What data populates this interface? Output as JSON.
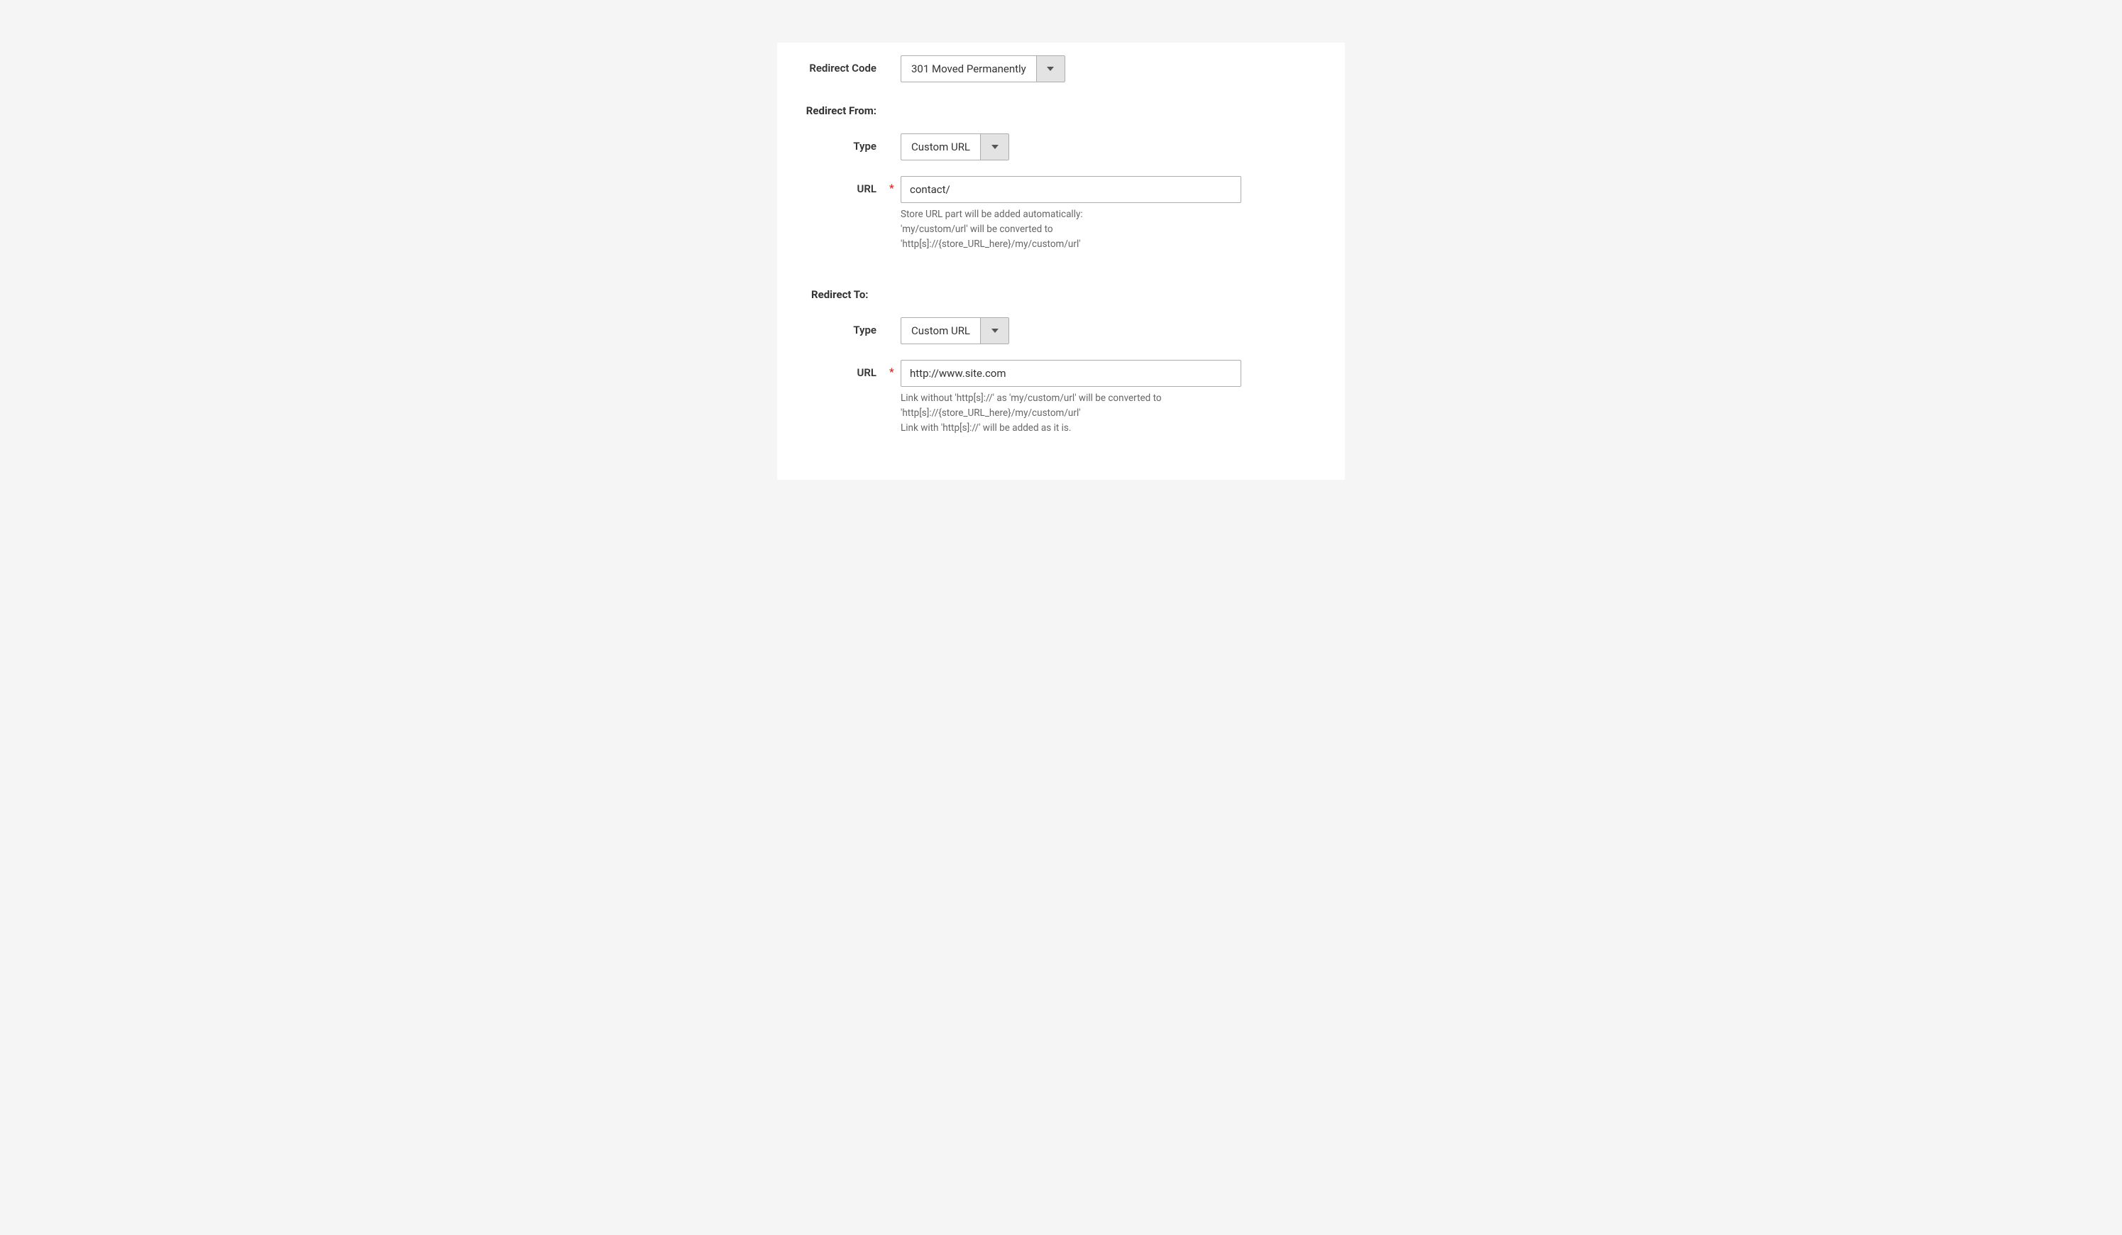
{
  "redirect_code": {
    "label": "Redirect Code",
    "value": "301 Moved Permanently"
  },
  "redirect_from": {
    "section_label": "Redirect From:",
    "type": {
      "label": "Type",
      "value": "Custom URL"
    },
    "url": {
      "label": "URL",
      "value": "contact/",
      "help": "Store URL part will be added automatically:\n'my/custom/url' will be converted to\n'http[s]://{store_URL_here}/my/custom/url'"
    }
  },
  "redirect_to": {
    "section_label": "Redirect To:",
    "type": {
      "label": "Type",
      "value": "Custom URL"
    },
    "url": {
      "label": "URL",
      "value": "http://www.site.com",
      "help": "Link without 'http[s]://' as 'my/custom/url' will be converted to\n'http[s]://{store_URL_here}/my/custom/url'\nLink with 'http[s]://' will be added as it is."
    }
  },
  "required_mark": "*"
}
